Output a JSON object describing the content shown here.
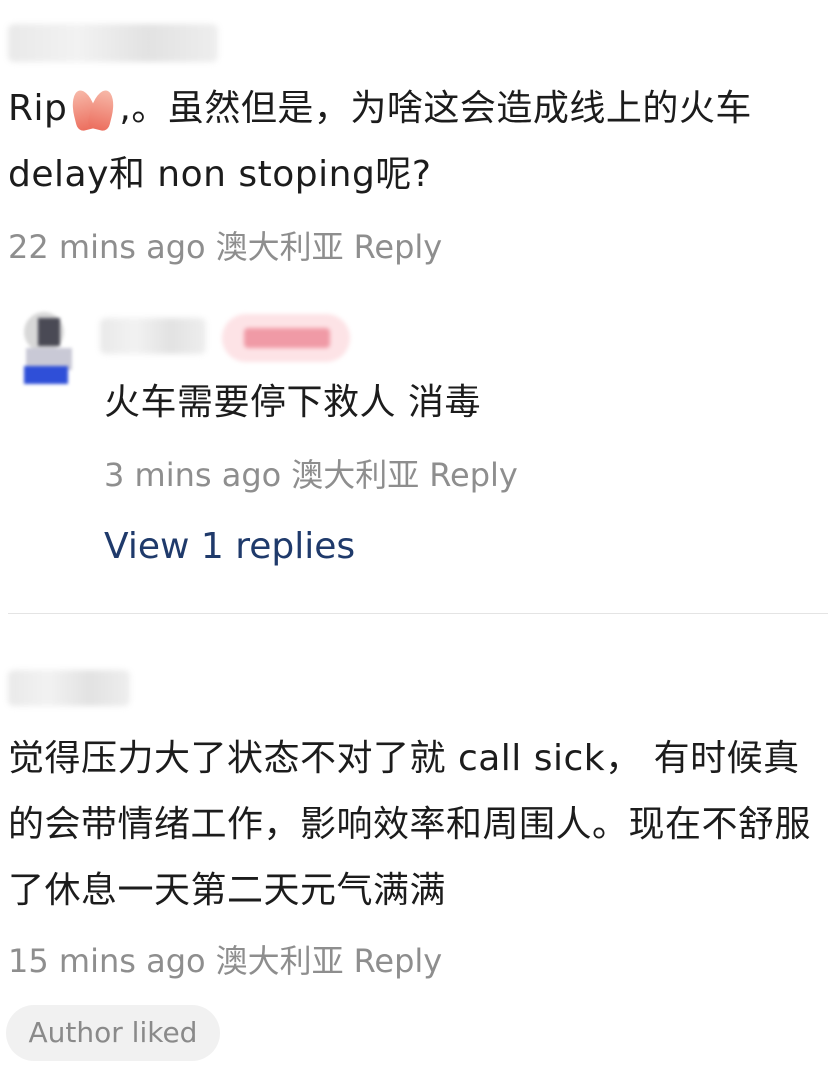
{
  "comments": [
    {
      "text_before_emoji": "Rip",
      "emoji_icon": "folded-hands-icon",
      "text_after_emoji": ",。虽然但是，为啥这会造成线上的火车 delay和 non stoping呢?",
      "time": "22 mins ago",
      "location": "澳大利亚",
      "reply_label": "Reply"
    },
    {
      "text": "觉得压力大了状态不对了就 call sick， 有时候真的会带情绪工作，影响效率和周围人。现在不舒服了休息一天第二天元气满满",
      "time": "15 mins ago",
      "location": "澳大利亚",
      "reply_label": "Reply",
      "author_liked_label": "Author liked"
    }
  ],
  "reply": {
    "text": "火车需要停下救人 消毒",
    "time": "3 mins ago",
    "location": "澳大利亚",
    "reply_label": "Reply"
  },
  "view_replies_label": "View 1 replies",
  "colors": {
    "link": "#1f3a6b",
    "meta": "#8e8e8e",
    "author_badge": "#fde3e6"
  }
}
